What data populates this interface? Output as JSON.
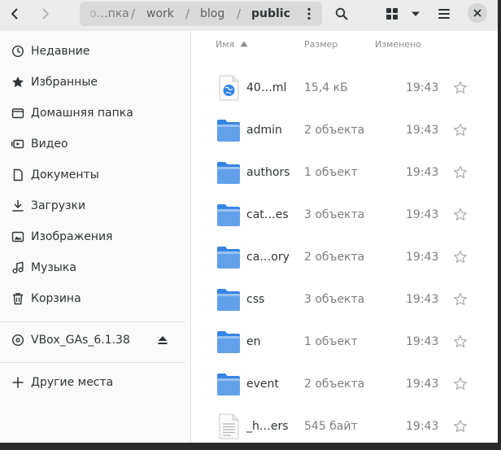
{
  "header": {
    "back_icon": "go-previous-icon",
    "forward_icon": "go-next-icon",
    "path": [
      {
        "label": "о…пка",
        "state": "faded"
      },
      {
        "label": "work"
      },
      {
        "label": "blog"
      },
      {
        "label": "public",
        "state": "current"
      }
    ],
    "separator": "/",
    "menu_icon": "view-more-icon",
    "search_icon": "search-icon",
    "grid_icon": "view-grid-icon",
    "dropdown_icon": "pan-down-icon",
    "hamburger_icon": "open-menu-icon",
    "close_icon": "close-icon"
  },
  "sidebar": {
    "items": [
      {
        "label": "Недавние",
        "icon": "recent-icon"
      },
      {
        "label": "Избранные",
        "icon": "starred-icon"
      },
      {
        "label": "Домашняя папка",
        "icon": "home-icon"
      },
      {
        "label": "Видео",
        "icon": "video-icon"
      },
      {
        "label": "Документы",
        "icon": "documents-icon"
      },
      {
        "label": "Загрузки",
        "icon": "downloads-icon"
      },
      {
        "label": "Изображения",
        "icon": "pictures-icon"
      },
      {
        "label": "Музыка",
        "icon": "music-icon"
      },
      {
        "label": "Корзина",
        "icon": "trash-icon"
      }
    ],
    "device": {
      "label": "VBox_GAs_6.1.38",
      "icon": "disc-icon",
      "eject_icon": "eject-icon"
    },
    "other": {
      "label": "Другие места",
      "icon": "plus-icon"
    }
  },
  "columns": {
    "name": "Имя",
    "size": "Размер",
    "modified": "Изменено"
  },
  "files": [
    {
      "name": "40…ml",
      "size": "15,4 кБ",
      "time": "19:43",
      "type": "html"
    },
    {
      "name": "admin",
      "size": "2 объекта",
      "time": "19:43",
      "type": "folder"
    },
    {
      "name": "authors",
      "size": "1 объект",
      "time": "19:43",
      "type": "folder"
    },
    {
      "name": "cat…es",
      "size": "3 объекта",
      "time": "19:43",
      "type": "folder"
    },
    {
      "name": "ca…ory",
      "size": "2 объекта",
      "time": "19:43",
      "type": "folder"
    },
    {
      "name": "css",
      "size": "3 объекта",
      "time": "19:43",
      "type": "folder"
    },
    {
      "name": "en",
      "size": "1 объект",
      "time": "19:43",
      "type": "folder"
    },
    {
      "name": "event",
      "size": "2 объекта",
      "time": "19:43",
      "type": "folder"
    },
    {
      "name": "_h…ers",
      "size": "545 байт",
      "time": "19:43",
      "type": "text"
    }
  ],
  "colors": {
    "folder": "#3584e4",
    "folder_light": "#62a0ea",
    "accent": "#3584e4"
  }
}
